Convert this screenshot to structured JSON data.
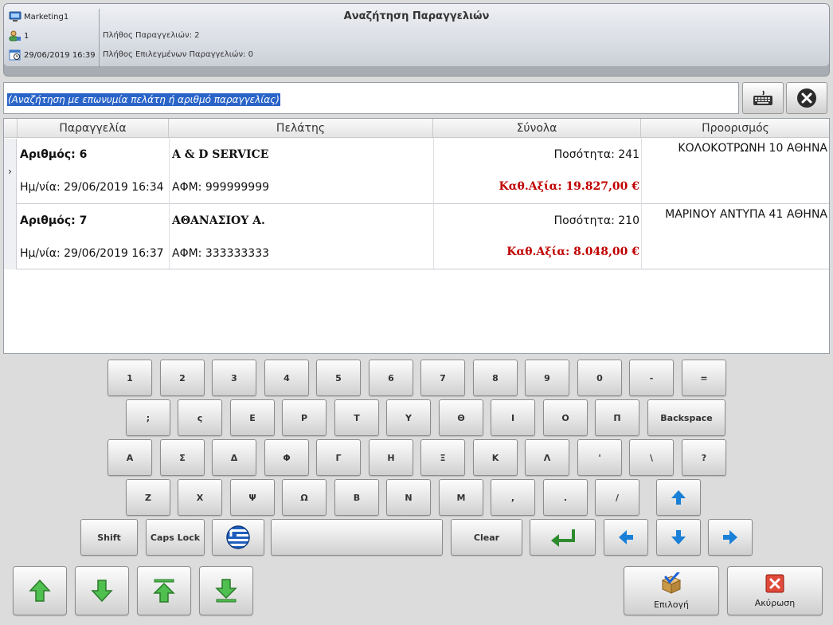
{
  "header": {
    "user": "Marketing1",
    "terminal": "1",
    "datetime": "29/06/2019 16:39",
    "title": "Αναζήτηση Παραγγελιών",
    "orders_count_label": "Πλήθος Παραγγελιών: 2",
    "selected_count_label": "Πλήθος Επιλεγμένων Παραγγελιών: 0"
  },
  "search": {
    "placeholder": "(Αναζήτηση με επωνυμία πελάτη ή αριθμό παραγγελίας)",
    "keyboard_icon": "keyboard-icon",
    "clear_icon": "close-circle-icon"
  },
  "table": {
    "columns": [
      "Παραγγελία",
      "Πελάτης",
      "Σύνολα",
      "Προορισμός"
    ],
    "rows": [
      {
        "order_no": "Αριθμός: 6",
        "date": "Ημ/νία: 29/06/2019 16:34",
        "customer": "A & D SERVICE",
        "vat": "ΑΦΜ: 999999999",
        "qty": "Ποσότητα:  241",
        "net_value": "Καθ.Αξία: 19.827,00 €",
        "destination": "ΚΟΛΟΚΟΤΡΩΝΗ 10 ΑΘΗΝΑ"
      },
      {
        "order_no": "Αριθμός: 7",
        "date": "Ημ/νία: 29/06/2019 16:37",
        "customer": "ΑΘΑΝΑΣΙΟΥ  Α.",
        "vat": "ΑΦΜ: 333333333",
        "qty": "Ποσότητα:  210",
        "net_value": "Καθ.Αξία: 8.048,00 €",
        "destination": "ΜΑΡΙΝΟΥ ΑΝΤΥΠΑ 41 ΑΘΗΝΑ"
      }
    ]
  },
  "keyboard": {
    "row1": [
      "1",
      "2",
      "3",
      "4",
      "5",
      "6",
      "7",
      "8",
      "9",
      "0",
      "-",
      "="
    ],
    "row2": [
      ";",
      "ς",
      "Ε",
      "Ρ",
      "Τ",
      "Υ",
      "Θ",
      "Ι",
      "Ο",
      "Π",
      "Backspace"
    ],
    "row3": [
      "Α",
      "Σ",
      "Δ",
      "Φ",
      "Γ",
      "Η",
      "Ξ",
      "Κ",
      "Λ",
      "'",
      "\\",
      "?"
    ],
    "row4": [
      "Ζ",
      "Χ",
      "Ψ",
      "Ω",
      "Β",
      "Ν",
      "Μ",
      ",",
      ".",
      "/"
    ],
    "shift": "Shift",
    "caps": "Caps Lock",
    "clear": "Clear"
  },
  "bottom": {
    "select_label": "Επιλογή",
    "cancel_label": "Ακύρωση"
  },
  "colors": {
    "accent_blue": "#1a7fd6",
    "arrow_green": "#3aa83a",
    "value_red": "#c00000",
    "search_highlight": "#2a64c8"
  }
}
